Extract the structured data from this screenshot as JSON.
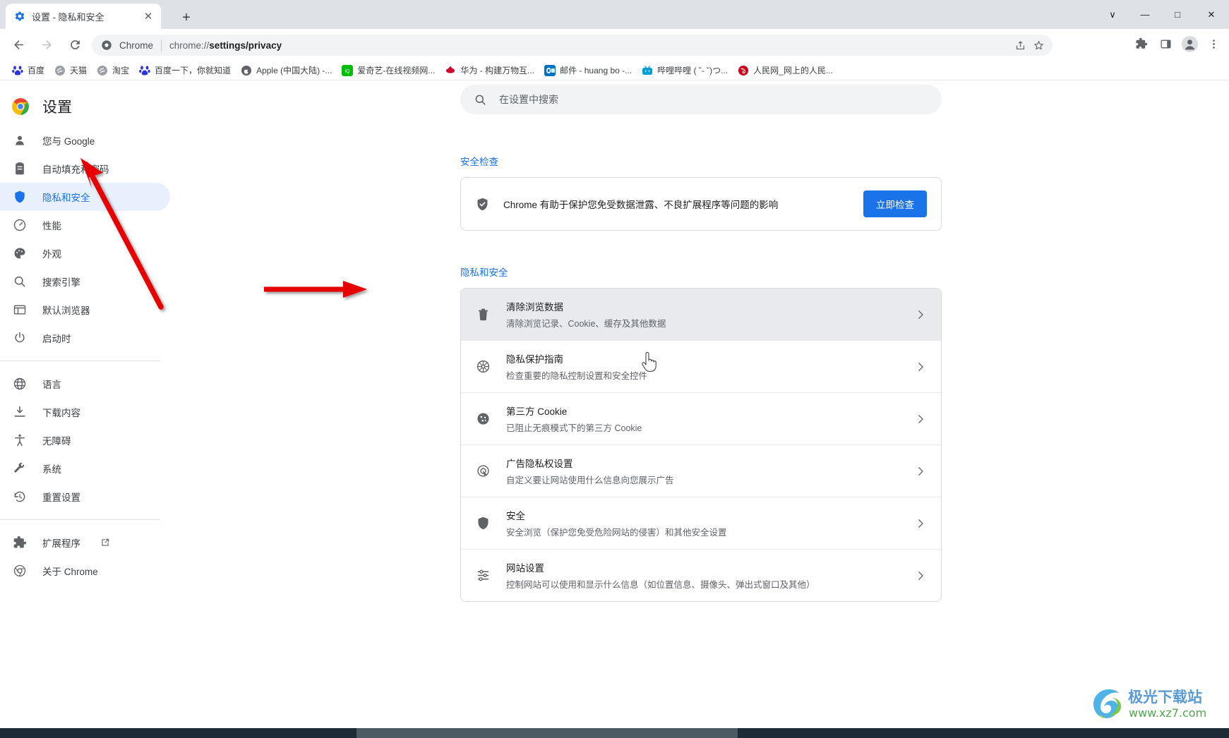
{
  "window": {
    "controls": [
      {
        "name": "tab-search",
        "glyph": "∨"
      },
      {
        "name": "minimize",
        "glyph": "—"
      },
      {
        "name": "maximize",
        "glyph": "□"
      },
      {
        "name": "close",
        "glyph": "✕"
      }
    ]
  },
  "tab": {
    "title": "设置 - 隐私和安全",
    "favicon": "settings-gear-icon",
    "close_glyph": "✕",
    "newtab_glyph": "+"
  },
  "toolbar": {
    "back": "←",
    "forward": "→",
    "reload": "⟳",
    "home": "⌂",
    "omnibox": {
      "brand": "Chrome",
      "url_prefix": "chrome://",
      "url_bold": "settings/privacy",
      "full_url": "chrome://settings/privacy",
      "icon": "chrome-logo-icon"
    },
    "right_icons": [
      {
        "name": "share-icon"
      },
      {
        "name": "bookmark-star-icon"
      },
      {
        "name": "extensions-puzzle-icon"
      },
      {
        "name": "side-panel-icon"
      },
      {
        "name": "profile-avatar-icon"
      },
      {
        "name": "three-dot-menu-icon"
      }
    ]
  },
  "bookmarks": [
    {
      "label": "百度",
      "icon": "baidu-icon",
      "color": "#2932e1"
    },
    {
      "label": "天猫",
      "icon": "tmall-icon",
      "color": "#9aa0a6"
    },
    {
      "label": "淘宝",
      "icon": "taobao-icon",
      "color": "#9aa0a6"
    },
    {
      "label": "百度一下，你就知道",
      "icon": "baidu-icon",
      "color": "#2932e1"
    },
    {
      "label": "Apple (中国大陆) -...",
      "icon": "apple-icon",
      "color": "#5f6368"
    },
    {
      "label": "爱奇艺-在线视频网...",
      "icon": "iqiyi-icon",
      "color": "#00be06"
    },
    {
      "label": "华为 - 构建万物互...",
      "icon": "huawei-icon",
      "color": "#cf0a2c"
    },
    {
      "label": "邮件 - huang bo -...",
      "icon": "outlook-icon",
      "color": "#0072c6"
    },
    {
      "label": "哔哩哔哩 ( ˘- ˘)つ...",
      "icon": "bilibili-icon",
      "color": "#00a1d6"
    },
    {
      "label": "人民网_网上的人民...",
      "icon": "people-icon",
      "color": "#d0021b"
    }
  ],
  "sidebar": {
    "brand": "设置",
    "brand_icon": "chrome-logo-icon",
    "groups": [
      {
        "items": [
          {
            "label": "您与 Google",
            "icon": "person-icon",
            "active": false
          },
          {
            "label": "自动填充和密码",
            "icon": "clipboard-icon",
            "active": false
          },
          {
            "label": "隐私和安全",
            "icon": "shield-icon",
            "active": true
          },
          {
            "label": "性能",
            "icon": "speedometer-icon",
            "active": false
          },
          {
            "label": "外观",
            "icon": "palette-icon",
            "active": false
          },
          {
            "label": "搜索引擎",
            "icon": "search-icon",
            "active": false
          },
          {
            "label": "默认浏览器",
            "icon": "browser-window-icon",
            "active": false
          },
          {
            "label": "启动时",
            "icon": "power-icon",
            "active": false
          }
        ]
      },
      {
        "items": [
          {
            "label": "语言",
            "icon": "globe-icon",
            "active": false
          },
          {
            "label": "下载内容",
            "icon": "download-icon",
            "active": false
          },
          {
            "label": "无障碍",
            "icon": "accessibility-icon",
            "active": false
          },
          {
            "label": "系统",
            "icon": "wrench-icon",
            "active": false
          },
          {
            "label": "重置设置",
            "icon": "history-restore-icon",
            "active": false
          }
        ]
      },
      {
        "items": [
          {
            "label": "扩展程序",
            "icon": "puzzle-icon",
            "active": false,
            "external": true
          },
          {
            "label": "关于 Chrome",
            "icon": "chrome-outline-icon",
            "active": false
          }
        ]
      }
    ]
  },
  "search": {
    "placeholder": "在设置中搜索",
    "icon": "search-icon"
  },
  "safety_check": {
    "title": "安全检查",
    "message": "Chrome 有助于保护您免受数据泄露、不良扩展程序等问题的影响",
    "icon": "shield-check-icon",
    "button": "立即检查",
    "button_color": "#1a73e8"
  },
  "privacy_section": {
    "title": "隐私和安全",
    "rows": [
      {
        "title": "清除浏览数据",
        "subtitle": "清除浏览记录、Cookie、缓存及其他数据",
        "icon": "trash-icon",
        "hover": true,
        "arrow": "›"
      },
      {
        "title": "隐私保护指南",
        "subtitle": "检查重要的隐私控制设置和安全控件",
        "icon": "privacy-guide-icon",
        "hover": false,
        "arrow": "›"
      },
      {
        "title": "第三方 Cookie",
        "subtitle": "已阻止无痕模式下的第三方 Cookie",
        "icon": "cookie-icon",
        "hover": false,
        "arrow": "›"
      },
      {
        "title": "广告隐私权设置",
        "subtitle": "自定义要让网站使用什么信息向您展示广告",
        "icon": "ad-privacy-icon",
        "hover": false,
        "arrow": "›"
      },
      {
        "title": "安全",
        "subtitle": "安全浏览（保护您免受危险网站的侵害）和其他安全设置",
        "icon": "security-shield-icon",
        "hover": false,
        "arrow": "›"
      },
      {
        "title": "网站设置",
        "subtitle": "控制网站可以使用和显示什么信息（如位置信息、摄像头、弹出式窗口及其他）",
        "icon": "sliders-icon",
        "hover": false,
        "arrow": "›"
      }
    ]
  },
  "annotations": {
    "color": "#e60000",
    "arrow1": "arrow-pointing-to-privacy-and-security",
    "arrow2": "arrow-pointing-to-clear-browsing-data"
  },
  "watermark": {
    "title": "极光下载站",
    "url": "www.xz7.com"
  }
}
